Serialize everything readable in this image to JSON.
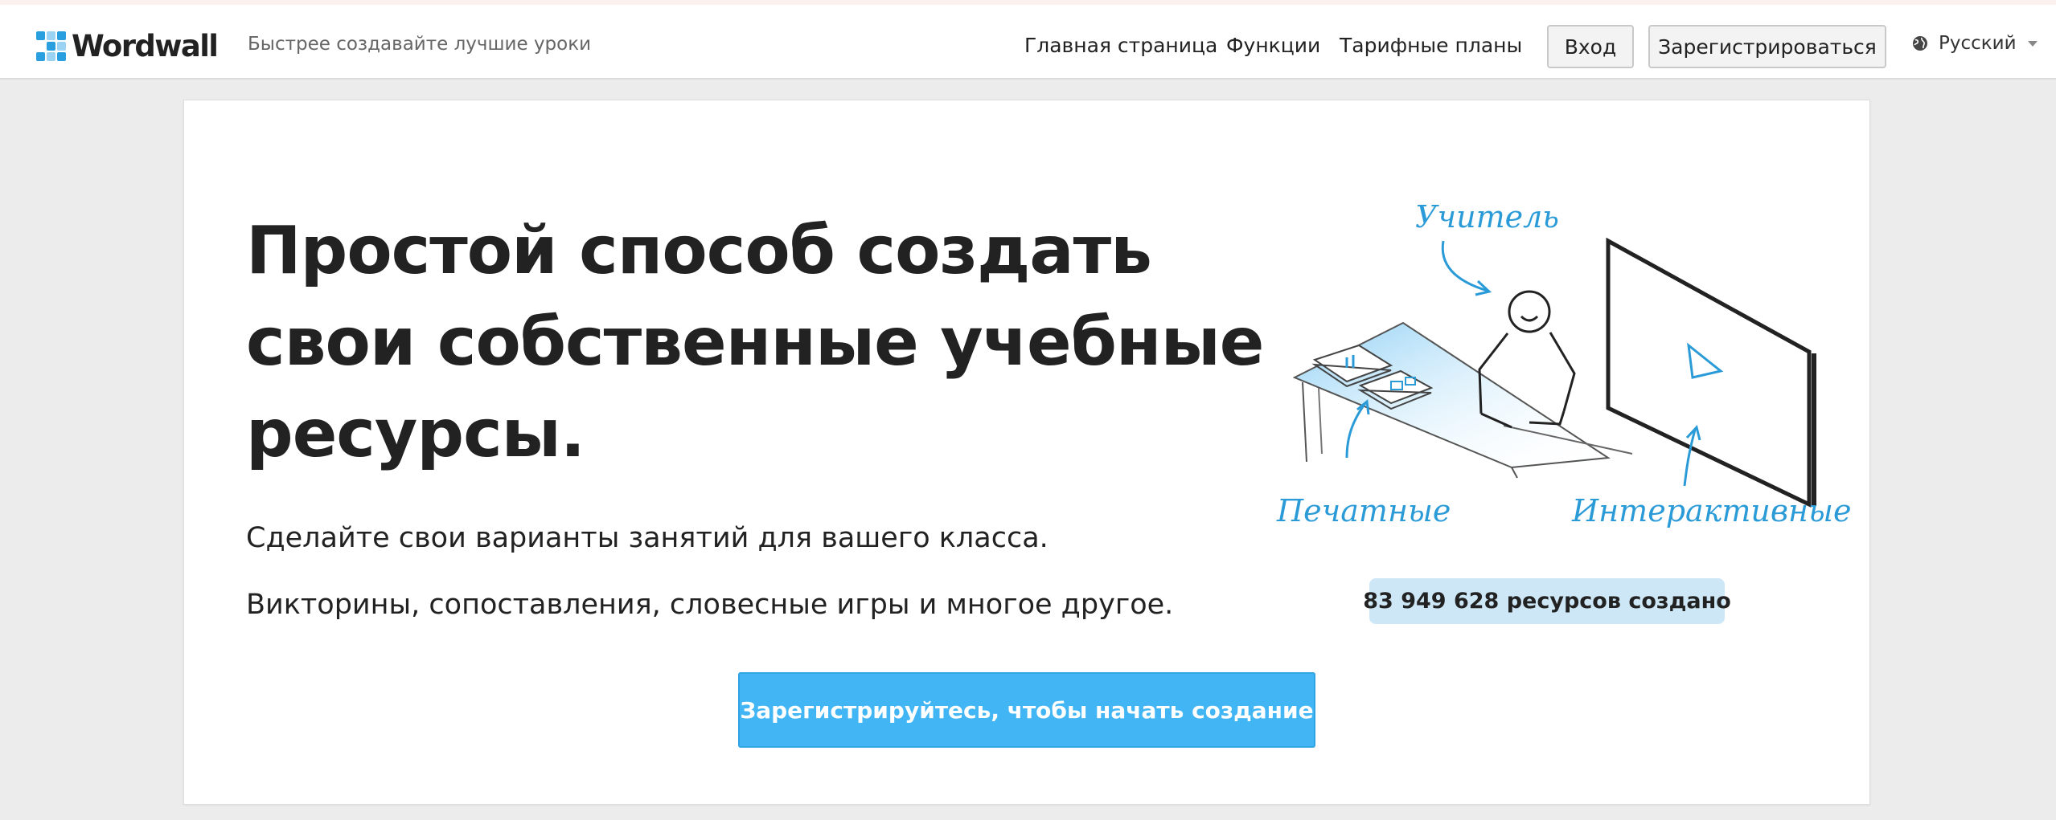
{
  "header": {
    "logo_text": "Wordwall",
    "tagline": "Быстрее создавайте лучшие уроки",
    "nav": {
      "home": "Главная страница",
      "features": "Функции",
      "pricing": "Тарифные планы"
    },
    "login_label": "Вход",
    "signup_label": "Зарегистрироваться",
    "language": "Русский"
  },
  "hero": {
    "headline": "Простой способ создать свои собственные учебные ресурсы.",
    "subtitle_1": "Сделайте свои варианты занятий для вашего класса.",
    "subtitle_2": "Викторины, сопоставления, словесные игры и многое другое.",
    "cta_label": "Зарегистрируйтесь, чтобы начать создание",
    "counter": "83 949 628 ресурсов создано"
  },
  "illustration": {
    "label_teacher": "Учитель",
    "label_printable": "Печатные",
    "label_interactive": "Интерактивные"
  },
  "colors": {
    "accent": "#42b6f5",
    "counter_bg": "#cde7f6",
    "illustration_blue": "#2b9bd8"
  },
  "icons": {
    "logo": "wordwall-grid-logo",
    "language": "globe-icon",
    "dropdown": "chevron-down-icon"
  }
}
